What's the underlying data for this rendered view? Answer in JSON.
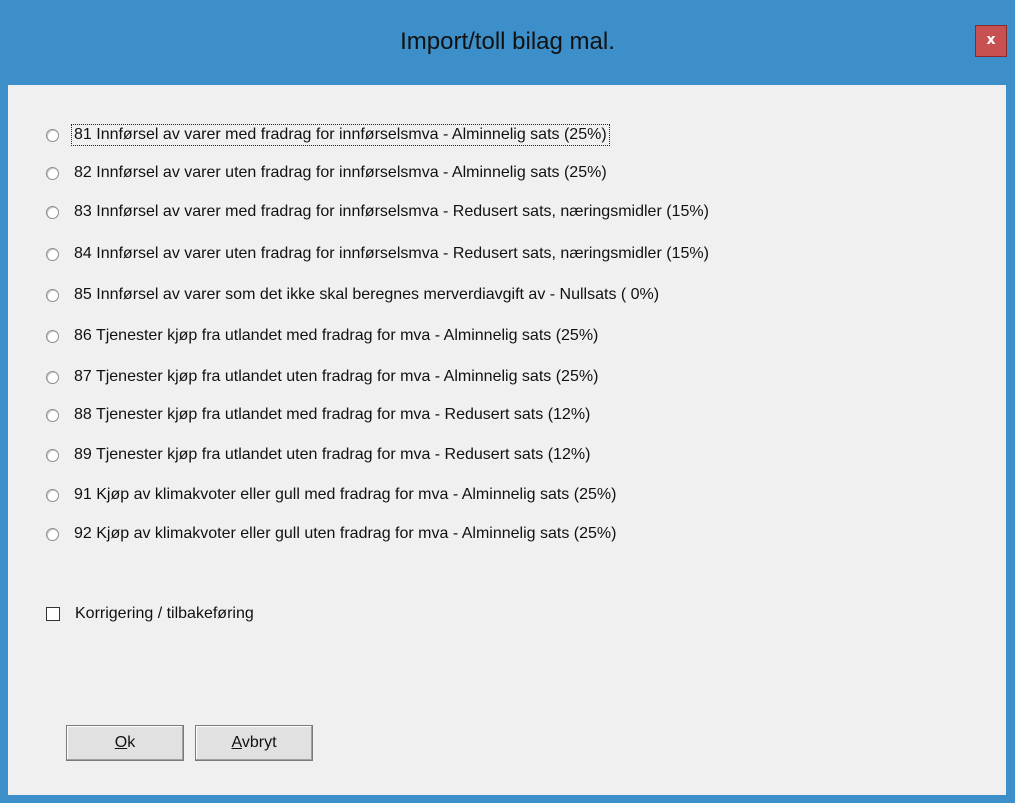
{
  "window": {
    "title": "Import/toll bilag mal.",
    "close_glyph": "x"
  },
  "options": [
    {
      "label": "81  Innførsel av varer med fradrag for innførselsmva - Alminnelig sats (25%)"
    },
    {
      "label": "82  Innførsel av varer uten fradrag for innførselsmva - Alminnelig sats (25%)"
    },
    {
      "label": "83  Innførsel av varer med fradrag for innførselsmva - Redusert sats, næringsmidler (15%)"
    },
    {
      "label": "84  Innførsel av varer uten fradrag for innførselsmva - Redusert sats, næringsmidler (15%)"
    },
    {
      "label": "85  Innførsel av varer som det ikke skal beregnes merverdiavgift av - Nullsats ( 0%)"
    },
    {
      "label": "86  Tjenester kjøp fra utlandet med fradrag for mva - Alminnelig sats (25%)"
    },
    {
      "label": "87  Tjenester kjøp fra utlandet uten fradrag for mva - Alminnelig sats (25%)"
    },
    {
      "label": "88  Tjenester kjøp fra utlandet med fradrag for mva - Redusert sats (12%)"
    },
    {
      "label": "89  Tjenester kjøp fra utlandet uten fradrag for mva - Redusert sats (12%)"
    },
    {
      "label": "91  Kjøp av klimakvoter eller gull med fradrag for mva - Alminnelig sats (25%)"
    },
    {
      "label": "92  Kjøp av klimakvoter eller gull uten fradrag for mva - Alminnelig sats (25%)"
    }
  ],
  "checkbox": {
    "label": "Korrigering / tilbakeføring",
    "checked": false
  },
  "buttons": {
    "ok_mnemonic": "O",
    "ok_rest": "k",
    "cancel_mnemonic": "A",
    "cancel_rest": "vbryt"
  },
  "colors": {
    "window_border": "#3c8fc9",
    "close_button": "#c75050",
    "client_background": "#f0f0f0"
  }
}
